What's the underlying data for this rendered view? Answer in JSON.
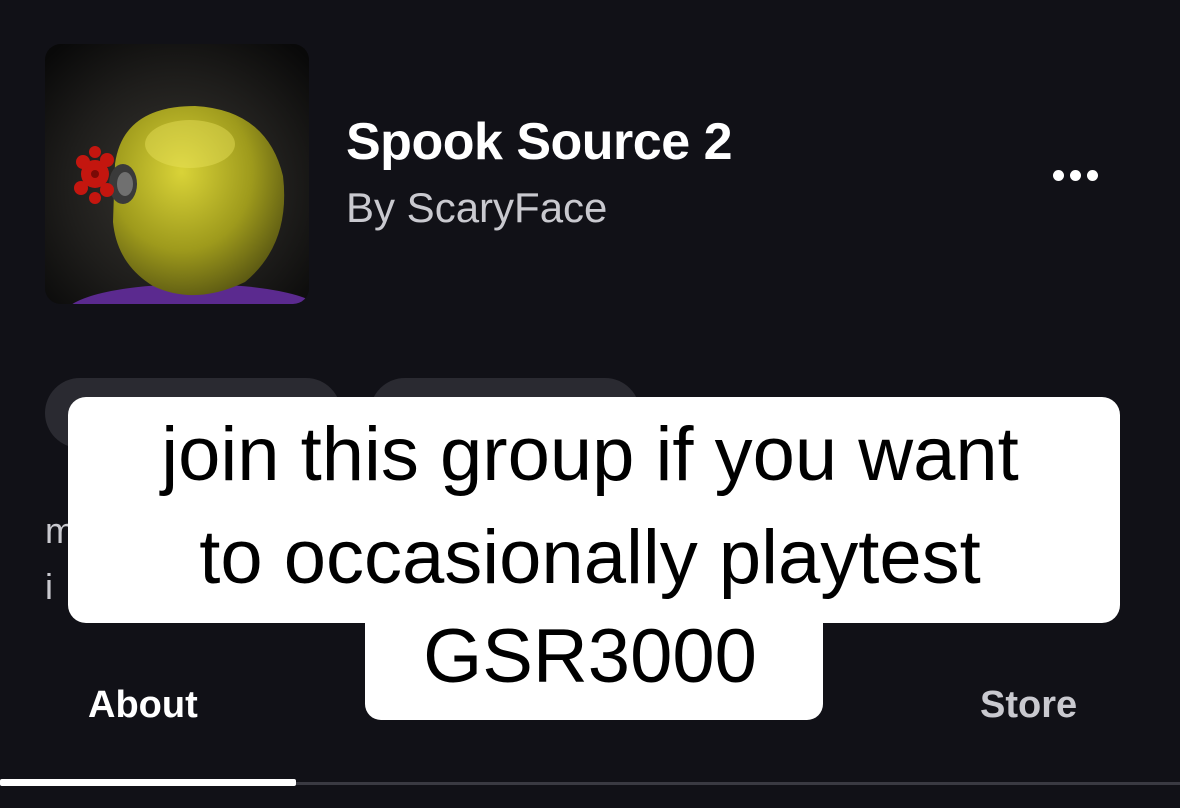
{
  "group": {
    "name": "Spook Source 2",
    "byline": "By ScaryFace",
    "icon": "group-icon-image"
  },
  "menu": {
    "more_icon": "more-horizontal-icon"
  },
  "description_fragments": [
    "m",
    "i"
  ],
  "tabs": [
    {
      "label": "About"
    },
    {
      "label": "Store"
    }
  ],
  "overlay_caption": {
    "lines": [
      "join this group if you want",
      "to occasionally playtest",
      "GSR3000"
    ]
  },
  "colors": {
    "background": "#111117",
    "pill": "#2a2a31",
    "caption_bg": "#ffffff",
    "caption_text": "#000000",
    "muted_text": "#c9c9cf"
  }
}
